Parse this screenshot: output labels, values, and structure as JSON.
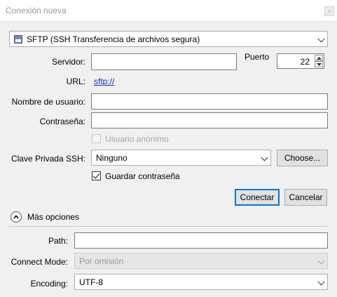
{
  "window": {
    "title": "Conexión nueva",
    "close": "×"
  },
  "protocol": {
    "selected": "SFTP (SSH Transferencia de archivos segura)",
    "icon": "server-icon"
  },
  "server": {
    "label": "Servidor:",
    "value": ""
  },
  "port": {
    "label": "Puerto",
    "value": "22"
  },
  "url": {
    "label": "URL:",
    "value": "sftp://"
  },
  "username": {
    "label": "Nombre de usuario:",
    "value": ""
  },
  "password": {
    "label": "Contraseña:",
    "value": ""
  },
  "anonymous": {
    "label": "Usuario anónimo",
    "checked": false,
    "enabled": false
  },
  "private_key": {
    "label": "Clave Privada SSH:",
    "selected": "Ninguno",
    "choose_label": "Choose..."
  },
  "save_password": {
    "label": "Guardar contraseña",
    "checked": true
  },
  "actions": {
    "connect_label": "Conectar",
    "cancel_label": "Cancelar"
  },
  "more_options": {
    "label": "Más opciones",
    "expanded": true
  },
  "path": {
    "label": "Path:",
    "value": ""
  },
  "connect_mode": {
    "label": "Connect Mode:",
    "selected": "Por omisión",
    "enabled": false
  },
  "encoding": {
    "label": "Encoding:",
    "selected": "UTF-8"
  },
  "colors": {
    "link": "#0033cc",
    "primary_border": "#0078d7",
    "background": "#f0f0f0"
  }
}
